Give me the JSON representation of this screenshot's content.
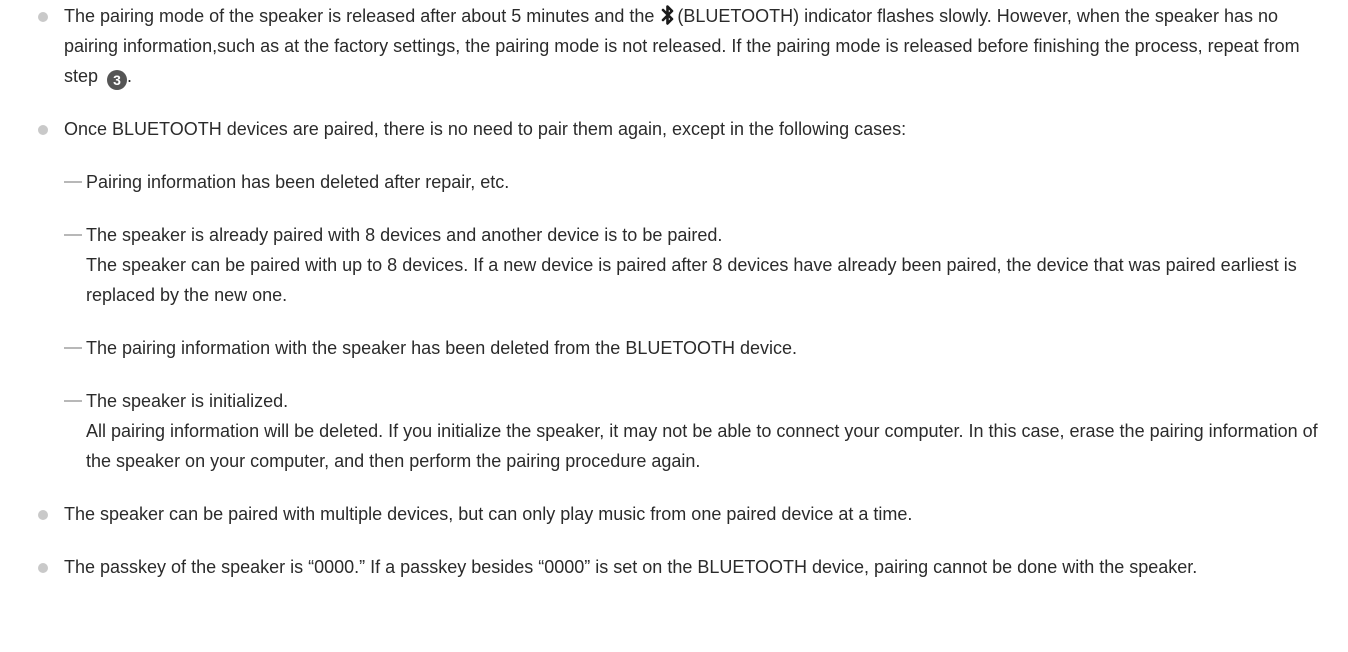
{
  "notes": [
    {
      "part1": "The pairing mode of the speaker is released after about 5 minutes and the",
      "icon": "bluetooth-icon",
      "part2": "(BLUETOOTH) indicator flashes slowly. However, when the speaker has no pairing information,such as at the factory settings, the pairing mode is not released. If the pairing mode is released before finishing the process, repeat from step",
      "step": "3",
      "part3": "."
    },
    {
      "text": "Once BLUETOOTH devices are paired, there is no need to pair them again, except in the following cases:"
    },
    {
      "text": "The speaker can be paired with multiple devices, but can only play music from one paired device at a time."
    },
    {
      "text": "The passkey of the speaker is “0000.” If a passkey besides “0000” is set on the BLUETOOTH device, pairing cannot be done with the speaker."
    }
  ],
  "cases": [
    {
      "title": "Pairing information has been deleted after repair, etc.",
      "detail": ""
    },
    {
      "title": "The speaker is already paired with 8 devices and another device is to be paired.",
      "detail": "The speaker can be paired with up to 8 devices. If a new device is paired after 8 devices have already been paired, the device that was paired earliest is replaced by the new one."
    },
    {
      "title": "The pairing information with the speaker has been deleted from the BLUETOOTH device.",
      "detail": ""
    },
    {
      "title": "The speaker is initialized.",
      "detail": "All pairing information will be deleted. If you initialize the speaker, it may not be able to connect your computer. In this case, erase the pairing information of the speaker on your computer, and then perform the pairing procedure again."
    }
  ],
  "colors": {
    "text": "#2b2b2b",
    "bullet": "#c9c9c9",
    "dash": "#b8b8b8",
    "badge": "#555555"
  }
}
